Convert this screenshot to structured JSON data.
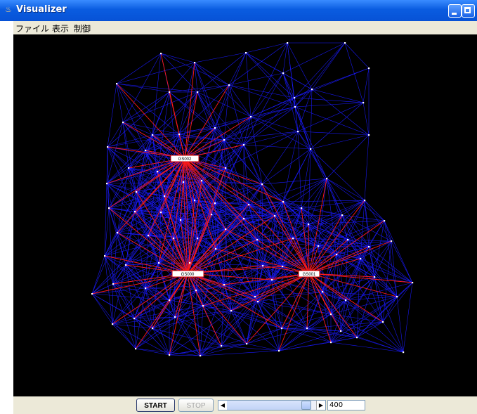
{
  "window": {
    "title": "Visualizer",
    "icon": "java-cup-icon"
  },
  "menu": [
    "ファイル",
    "表示",
    "制御"
  ],
  "colors": {
    "background": "#000000",
    "edge": "#1a1aff",
    "base_edge": "#ff1a1a",
    "node": "#ffffff",
    "base_label_bg": "#ffffff",
    "base_label_border": "#cc0000"
  },
  "bases": [
    {
      "label": "GS002"
    },
    {
      "label": "GS000"
    },
    {
      "label": "GS001"
    }
  ],
  "controls": {
    "start_label": "START",
    "stop_label": "STOP",
    "slider_value": 0.93,
    "value": "400"
  }
}
